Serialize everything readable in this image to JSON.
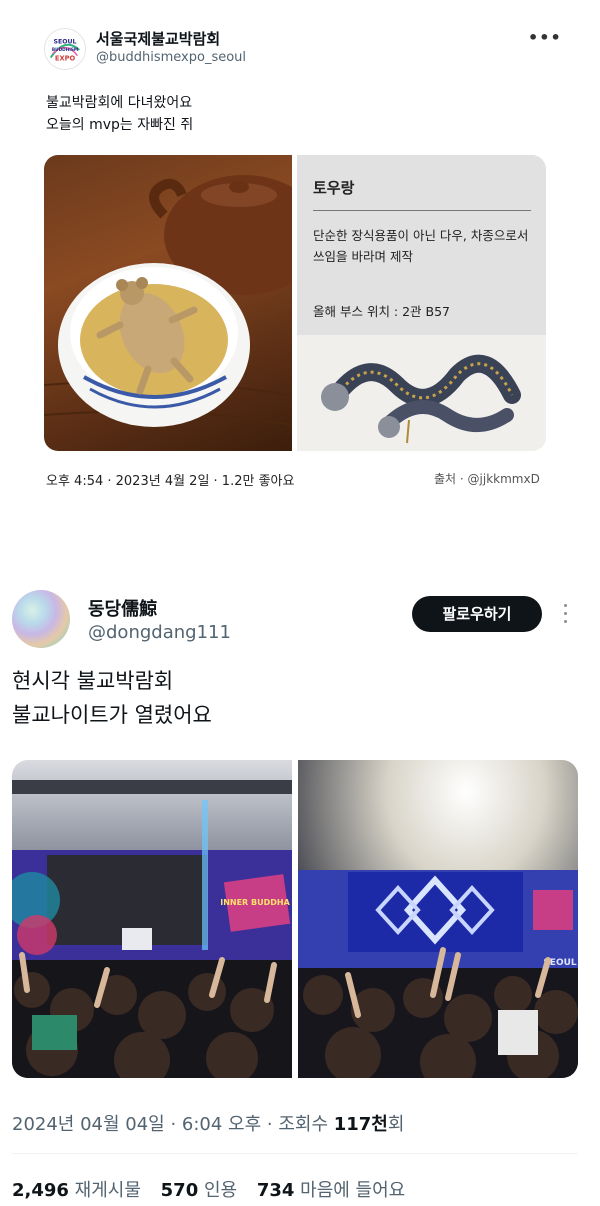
{
  "tweet1": {
    "account_name": "서울국제불교박람회",
    "handle": "@buddhismexpo_seoul",
    "more_icon": "more-dots-icon",
    "text_lines": [
      "불교박람회에 다녀왔어요",
      "오늘의 mvp는 자빠진 쥐"
    ],
    "card": {
      "title": "토우랑",
      "description": "단순한 장식용품이 아닌 다우, 차종으로서 쓰임을 바라며 제작",
      "booth": "올해 부스 위치 : 2관 B57"
    },
    "meta": "오후 4:54 · 2023년 4월 2일 · 1.2만 좋아요",
    "source": "출처 · @jjkkmmxD",
    "avatar_logo_lines": [
      "SEOUL",
      "BUDDHISM",
      "EXPO"
    ]
  },
  "tweet2": {
    "display_name": "동당儒鯨",
    "handle": "@dongdang111",
    "follow_label": "팔로우하기",
    "text_lines": [
      "현시각 불교박람회",
      "불교나이트가 열렸어요"
    ],
    "date": "2024년 04월 04일 · 6:04 오후 · 조회수 ",
    "views_count": "117천",
    "views_suffix": "회",
    "stats": {
      "retweets": "2,496",
      "retweets_label": "재게시물",
      "quotes": "570",
      "quotes_label": "인용",
      "likes": "734",
      "likes_label": "마음에 들어요"
    },
    "stage_sign": "INNER BUDDHA",
    "stage_sign2": "SEOUL"
  },
  "colors": {
    "text_primary": "#0f1419",
    "text_secondary": "#536471",
    "follow_bg": "#0f1419",
    "card_bg": "#e1e1e1"
  }
}
